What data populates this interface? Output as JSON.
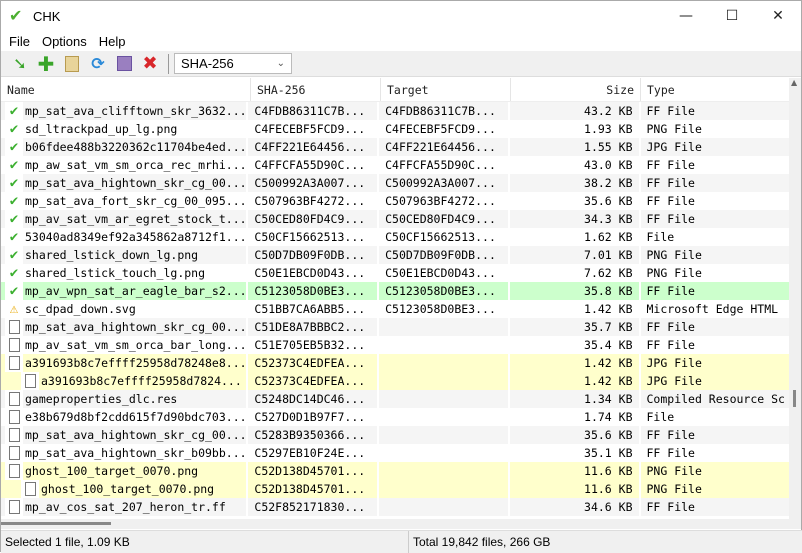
{
  "window": {
    "title": "CHK",
    "minimize": "—",
    "maximize": "☐",
    "close": "✕"
  },
  "menu": [
    "File",
    "Options",
    "Help"
  ],
  "toolbar": {
    "hash_select": "SHA-256"
  },
  "columns": [
    "Name",
    "SHA-256",
    "Target",
    "Size",
    "Type"
  ],
  "rows": [
    {
      "status": "ok",
      "name": "mp_sat_ava_clifftown_skr_3632...",
      "sha": "C4FDB86311C7B...",
      "target": "C4FDB86311C7B...",
      "size": "43.2 KB",
      "type": "FF File"
    },
    {
      "status": "ok",
      "name": "sd_ltrackpad_up_lg.png",
      "sha": "C4FECEBF5FCD9...",
      "target": "C4FECEBF5FCD9...",
      "size": "1.93 KB",
      "type": "PNG File"
    },
    {
      "status": "ok",
      "name": "b06fdee488b3220362c11704be4ed...",
      "sha": "C4FF221E64456...",
      "target": "C4FF221E64456...",
      "size": "1.55 KB",
      "type": "JPG File"
    },
    {
      "status": "ok",
      "name": "mp_aw_sat_vm_sm_orca_rec_mrhi...",
      "sha": "C4FFCFA55D90C...",
      "target": "C4FFCFA55D90C...",
      "size": "43.0 KB",
      "type": "FF File"
    },
    {
      "status": "ok",
      "name": "mp_sat_ava_hightown_skr_cg_00...",
      "sha": "C500992A3A007...",
      "target": "C500992A3A007...",
      "size": "38.2 KB",
      "type": "FF File"
    },
    {
      "status": "ok",
      "name": "mp_sat_ava_fort_skr_cg_00_095...",
      "sha": "C507963BF4272...",
      "target": "C507963BF4272...",
      "size": "35.6 KB",
      "type": "FF File"
    },
    {
      "status": "ok",
      "name": "mp_av_sat_vm_ar_egret_stock_t...",
      "sha": "C50CED80FD4C9...",
      "target": "C50CED80FD4C9...",
      "size": "34.3 KB",
      "type": "FF File"
    },
    {
      "status": "ok",
      "name": "53040ad8349ef92a345862a8712f1...",
      "sha": "C50CF15662513...",
      "target": "C50CF15662513...",
      "size": "1.62 KB",
      "type": "File"
    },
    {
      "status": "ok",
      "name": "shared_lstick_down_lg.png",
      "sha": "C50D7DB09F0DB...",
      "target": "C50D7DB09F0DB...",
      "size": "7.01 KB",
      "type": "PNG File"
    },
    {
      "status": "ok",
      "name": "shared_lstick_touch_lg.png",
      "sha": "C50E1EBCD0D43...",
      "target": "C50E1EBCD0D43...",
      "size": "7.62 KB",
      "type": "PNG File"
    },
    {
      "status": "ok",
      "hl": "green",
      "name": "mp_av_wpn_sat_ar_eagle_bar_s2...",
      "sha": "C5123058D0BE3...",
      "target": "C5123058D0BE3...",
      "size": "35.8 KB",
      "type": "FF File"
    },
    {
      "status": "warn",
      "name": "sc_dpad_down.svg",
      "sha": "C51BB7CA6ABB5...",
      "target": "C5123058D0BE3...",
      "size": "1.42 KB",
      "type": "Microsoft Edge HTML"
    },
    {
      "status": "file",
      "name": "mp_sat_ava_hightown_skr_cg_00...",
      "sha": "C51DE8A7BBBC2...",
      "target": "",
      "size": "35.7 KB",
      "type": "FF File"
    },
    {
      "status": "file",
      "name": "mp_av_sat_vm_sm_orca_bar_long...",
      "sha": "C51E705EB5B32...",
      "target": "",
      "size": "35.4 KB",
      "type": "FF File"
    },
    {
      "status": "file",
      "hl": "yellow",
      "name": "a391693b8c7effff25958d78248e8...",
      "sha": "C52373C4EDFEA...",
      "target": "",
      "size": "1.42 KB",
      "type": "JPG File"
    },
    {
      "status": "file",
      "hl": "yellow",
      "child": true,
      "name": "a391693b8c7effff25958d7824...",
      "sha": "C52373C4EDFEA...",
      "target": "",
      "size": "1.42 KB",
      "type": "JPG File"
    },
    {
      "status": "file",
      "name": "gameproperties_dlc.res",
      "sha": "C5248DC14DC46...",
      "target": "",
      "size": "1.34 KB",
      "type": "Compiled Resource Sc"
    },
    {
      "status": "file",
      "name": "e38b679d8bf2cdd615f7d90bdc703...",
      "sha": "C527D0D1B97F7...",
      "target": "",
      "size": "1.74 KB",
      "type": "File"
    },
    {
      "status": "file",
      "name": "mp_sat_ava_hightown_skr_cg_00...",
      "sha": "C5283B9350366...",
      "target": "",
      "size": "35.6 KB",
      "type": "FF File"
    },
    {
      "status": "file",
      "name": "mp_sat_ava_hightown_skr_b09bb...",
      "sha": "C5297EB10F24E...",
      "target": "",
      "size": "35.1 KB",
      "type": "FF File"
    },
    {
      "status": "file",
      "hl": "yellow",
      "name": "ghost_100_target_0070.png",
      "sha": "C52D138D45701...",
      "target": "",
      "size": "11.6 KB",
      "type": "PNG File"
    },
    {
      "status": "file",
      "hl": "yellow",
      "child": true,
      "name": "ghost_100_target_0070.png",
      "sha": "C52D138D45701...",
      "target": "",
      "size": "11.6 KB",
      "type": "PNG File"
    },
    {
      "status": "file",
      "name": "mp_av_cos_sat_207_heron_tr.ff",
      "sha": "C52F852171830...",
      "target": "",
      "size": "34.6 KB",
      "type": "FF File"
    }
  ],
  "status": {
    "selection": "Selected 1 file, 1.09 KB",
    "total": "Total 19,842 files, 266 GB"
  },
  "colors": {
    "ok_highlight": "#ccffcc",
    "dup_highlight": "#ffffcc"
  }
}
